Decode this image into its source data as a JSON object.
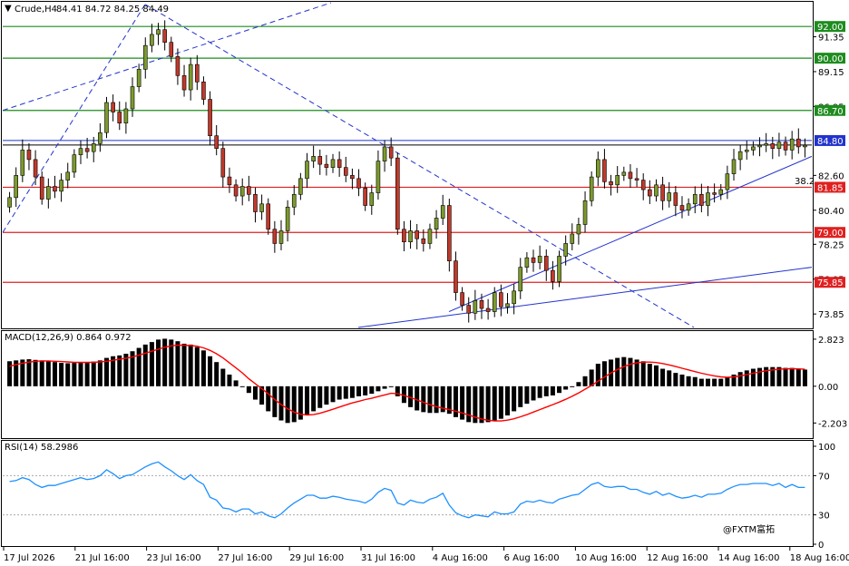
{
  "symbol": "Crude,H4",
  "ohlc": "84.41 84.72 84.25 84.49",
  "watermark": "@FXTM富拓",
  "fib_label": "38.2",
  "colors": {
    "up": "#7c9a2e",
    "down": "#c0392b",
    "green_level": "#1e8c1e",
    "red_level": "#e02020",
    "trend_blue": "#2233cc",
    "macd_signal": "#ff0000",
    "rsi": "#1e90ff"
  },
  "chart_data": [
    {
      "type": "candlestick",
      "title": "Crude,H4",
      "ylim": [
        73.0,
        93.5
      ],
      "y_ticks": [
        "91.35",
        "89.15",
        "86.95",
        "82.60",
        "80.40",
        "78.25",
        "76.05",
        "73.85"
      ],
      "levels_green": [
        "92.00",
        "90.00",
        "86.70"
      ],
      "levels_red": [
        "81.85",
        "79.00",
        "75.85"
      ],
      "price_label": "84.80",
      "x_labels": [
        "17 Jul 2026",
        "21 Jul 16:00",
        "23 Jul 16:00",
        "27 Jul 16:00",
        "29 Jul 16:00",
        "31 Jul 16:00",
        "4 Aug 16:00",
        "6 Aug 16:00",
        "10 Aug 16:00",
        "12 Aug 16:00",
        "14 Aug 16:00",
        "18 Aug 16:00"
      ],
      "closes": [
        81.2,
        82.6,
        84.2,
        83.6,
        82.5,
        81.1,
        81.9,
        81.6,
        82.3,
        82.8,
        83.9,
        84.3,
        84.1,
        84.6,
        85.3,
        87.2,
        86.6,
        85.9,
        86.8,
        88.2,
        89.3,
        90.8,
        91.5,
        91.8,
        91.0,
        90.1,
        88.9,
        88.0,
        89.6,
        88.5,
        87.4,
        85.1,
        84.3,
        82.5,
        82.0,
        81.3,
        81.9,
        81.4,
        80.3,
        80.8,
        79.2,
        78.3,
        79.1,
        80.6,
        81.4,
        82.4,
        83.5,
        83.8,
        83.3,
        83.1,
        83.6,
        83.1,
        82.6,
        82.4,
        81.8,
        80.7,
        81.5,
        83.5,
        84.4,
        83.7,
        79.2,
        78.4,
        79.1,
        78.6,
        78.3,
        79.2,
        79.9,
        80.7,
        77.2,
        75.2,
        74.4,
        73.9,
        74.7,
        74.2,
        74.0,
        75.2,
        74.3,
        74.5,
        75.3,
        76.8,
        77.4,
        77.1,
        77.5,
        76.6,
        75.9,
        77.5,
        78.3,
        78.9,
        79.5,
        81.0,
        82.5,
        83.6,
        82.2,
        82.0,
        82.6,
        82.8,
        82.4,
        82.3,
        81.7,
        81.3,
        82.0,
        81.0,
        81.5,
        80.7,
        80.4,
        80.8,
        81.4,
        80.7,
        81.5,
        81.4,
        81.7,
        82.7,
        83.6,
        84.1,
        84.2,
        84.4,
        84.5,
        84.6,
        84.3,
        84.7,
        84.2,
        84.9,
        84.4,
        84.5
      ],
      "trendlines": true
    },
    {
      "type": "bar",
      "title": "MACD(12,26,9) 0.864 0.972",
      "y_ticks": [
        "2.823",
        "0.00",
        "-2.203"
      ],
      "ylim": [
        -3.0,
        3.2
      ],
      "histogram": [
        1.5,
        1.55,
        1.6,
        1.62,
        1.58,
        1.55,
        1.5,
        1.45,
        1.4,
        1.38,
        1.4,
        1.42,
        1.45,
        1.48,
        1.55,
        1.7,
        1.8,
        1.85,
        1.95,
        2.1,
        2.3,
        2.5,
        2.65,
        2.8,
        2.85,
        2.8,
        2.7,
        2.55,
        2.5,
        2.35,
        2.15,
        1.8,
        1.45,
        1.05,
        0.7,
        0.35,
        0.0,
        -0.4,
        -0.8,
        -1.1,
        -1.5,
        -1.85,
        -2.05,
        -2.2,
        -2.15,
        -2.0,
        -1.75,
        -1.5,
        -1.3,
        -1.1,
        -0.95,
        -0.8,
        -0.75,
        -0.7,
        -0.6,
        -0.55,
        -0.45,
        -0.3,
        -0.15,
        -0.05,
        -0.6,
        -1.0,
        -1.25,
        -1.45,
        -1.55,
        -1.6,
        -1.6,
        -1.55,
        -1.65,
        -1.85,
        -2.0,
        -2.15,
        -2.2,
        -2.2,
        -2.15,
        -2.05,
        -1.95,
        -1.75,
        -1.5,
        -1.25,
        -1.05,
        -0.85,
        -0.7,
        -0.6,
        -0.55,
        -0.4,
        -0.2,
        0.0,
        0.25,
        0.6,
        1.0,
        1.35,
        1.5,
        1.6,
        1.7,
        1.75,
        1.7,
        1.6,
        1.5,
        1.35,
        1.25,
        1.05,
        0.95,
        0.8,
        0.7,
        0.6,
        0.55,
        0.45,
        0.45,
        0.45,
        0.45,
        0.55,
        0.7,
        0.85,
        0.95,
        1.05,
        1.1,
        1.15,
        1.15,
        1.15,
        1.1,
        1.1,
        1.05,
        1.0
      ],
      "signal": [
        1.2,
        1.3,
        1.38,
        1.45,
        1.5,
        1.52,
        1.52,
        1.5,
        1.48,
        1.46,
        1.44,
        1.43,
        1.43,
        1.44,
        1.46,
        1.5,
        1.56,
        1.62,
        1.68,
        1.76,
        1.86,
        1.98,
        2.1,
        2.22,
        2.34,
        2.42,
        2.46,
        2.46,
        2.44,
        2.4,
        2.3,
        2.15,
        1.95,
        1.7,
        1.4,
        1.1,
        0.8,
        0.45,
        0.15,
        -0.15,
        -0.45,
        -0.8,
        -1.1,
        -1.35,
        -1.55,
        -1.68,
        -1.72,
        -1.7,
        -1.62,
        -1.5,
        -1.38,
        -1.25,
        -1.12,
        -1.0,
        -0.9,
        -0.8,
        -0.72,
        -0.62,
        -0.52,
        -0.42,
        -0.45,
        -0.55,
        -0.68,
        -0.82,
        -0.96,
        -1.1,
        -1.22,
        -1.32,
        -1.4,
        -1.5,
        -1.6,
        -1.72,
        -1.85,
        -1.96,
        -2.04,
        -2.08,
        -2.08,
        -2.03,
        -1.95,
        -1.83,
        -1.7,
        -1.55,
        -1.4,
        -1.25,
        -1.1,
        -0.95,
        -0.78,
        -0.6,
        -0.4,
        -0.18,
        0.05,
        0.3,
        0.55,
        0.8,
        1.0,
        1.18,
        1.32,
        1.4,
        1.45,
        1.45,
        1.42,
        1.36,
        1.28,
        1.18,
        1.08,
        0.98,
        0.88,
        0.78,
        0.7,
        0.62,
        0.56,
        0.54,
        0.56,
        0.62,
        0.7,
        0.78,
        0.86,
        0.93,
        0.98,
        1.02,
        1.04,
        1.05,
        1.04,
        1.02
      ]
    },
    {
      "type": "line",
      "title": "RSI(14) 58.2986",
      "y_ticks": [
        "100",
        "70",
        "30",
        "0"
      ],
      "ylim": [
        0,
        100
      ],
      "values": [
        64,
        65,
        68,
        66,
        61,
        58,
        60,
        60,
        62,
        64,
        66,
        68,
        66,
        67,
        70,
        76,
        72,
        67,
        70,
        71,
        75,
        79,
        82,
        84,
        79,
        75,
        70,
        66,
        71,
        65,
        61,
        48,
        45,
        37,
        36,
        33,
        36,
        36,
        31,
        33,
        29,
        27,
        31,
        37,
        42,
        46,
        50,
        50,
        47,
        47,
        49,
        48,
        46,
        45,
        44,
        42,
        46,
        53,
        57,
        55,
        42,
        40,
        45,
        43,
        42,
        46,
        48,
        52,
        40,
        32,
        29,
        27,
        30,
        29,
        28,
        33,
        31,
        31,
        33,
        41,
        44,
        43,
        45,
        43,
        42,
        46,
        48,
        50,
        51,
        56,
        61,
        63,
        59,
        58,
        59,
        59,
        56,
        56,
        53,
        51,
        54,
        50,
        52,
        49,
        47,
        48,
        50,
        48,
        51,
        51,
        52,
        56,
        59,
        61,
        61,
        62,
        62,
        62,
        60,
        62,
        58,
        61,
        58,
        58
      ]
    }
  ]
}
